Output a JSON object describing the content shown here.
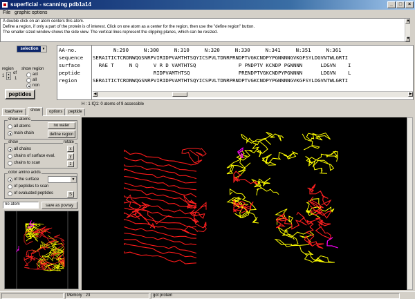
{
  "window": {
    "title": "superficial - scanning pdb1a14"
  },
  "menu": [
    {
      "label": "File"
    },
    {
      "label": "graphic options"
    }
  ],
  "help_lines": [
    "A double click on an atom centers this atom.",
    "Define a region, if only a part of the protein is of interest. Click on one atom as a center for the region, then use the \"define region\" button.",
    "The smaller sized window shows the side view. The vertical lines represent the clipping planes, which can be resized."
  ],
  "selection": {
    "label": "selection"
  },
  "region": {
    "label": "region",
    "value": "1",
    "of": "of",
    "total": "1"
  },
  "show_region": {
    "label": "show region",
    "options": [
      "act",
      "all",
      "non"
    ],
    "selected": 2
  },
  "peptides_button": "peptides",
  "sequence": {
    "labels": [
      "AA-no.",
      "sequence",
      "surface",
      "peptide",
      "region"
    ],
    "numbers": "N:290     N:300     N:310     N:320     N:330     N:341     N:351     N:361",
    "rows": [
      "SERAITICTCRDNWQGSNRPVIRIDPVAMTHTSQYICSPVLTDNRPRNDPTVGKCNDPYPGNNNNGVKGFSYLDGVNTWLGRTI",
      "  RAE T     N Q     V R D VAMTHTSQ              P PNDPTV KCNDP PGNNNN      LDGVN    I",
      "                    RIDPVAMTHTSQ                PRENDPTVGKCNDPYPGNNNN      LDGVN    L",
      "SERAITICTCRDNWQGSNRPVIRIDPVAMTHTSQYICSPVLTDNRPRNDPTVGKCNDPYPGNNNNGVKGFSYLDGVNTWLGRTI"
    ]
  },
  "info_line": "H : 1  IQ1: 0 atoms of 9 accessible",
  "tabs": [
    {
      "label": "load/save"
    },
    {
      "label": "show"
    },
    {
      "label": "options"
    },
    {
      "label": "peptide"
    }
  ],
  "active_tab": 1,
  "show_atoms": {
    "label": "show atoms",
    "options": [
      "all atoms",
      "main chain"
    ],
    "selected": 1,
    "no_water": "no water",
    "define_region": "define region"
  },
  "show": {
    "label": "show",
    "options": [
      "all chains",
      "chains of surface eval.",
      "chains to scan"
    ],
    "selected": 0,
    "rotate_label": "rotate",
    "rotate_buttons": [
      "x",
      "y",
      "z"
    ]
  },
  "color": {
    "label": "color amino acids",
    "options": [
      "of the surface",
      "of peptides to scan",
      "of evaluated peptides"
    ],
    "selected": 0,
    "check_button": "S"
  },
  "atom_field": {
    "value": "no atom"
  },
  "save_povray": "save as povray",
  "status": {
    "cell1": "",
    "memory": "Memory : 23",
    "message": "got protein"
  }
}
